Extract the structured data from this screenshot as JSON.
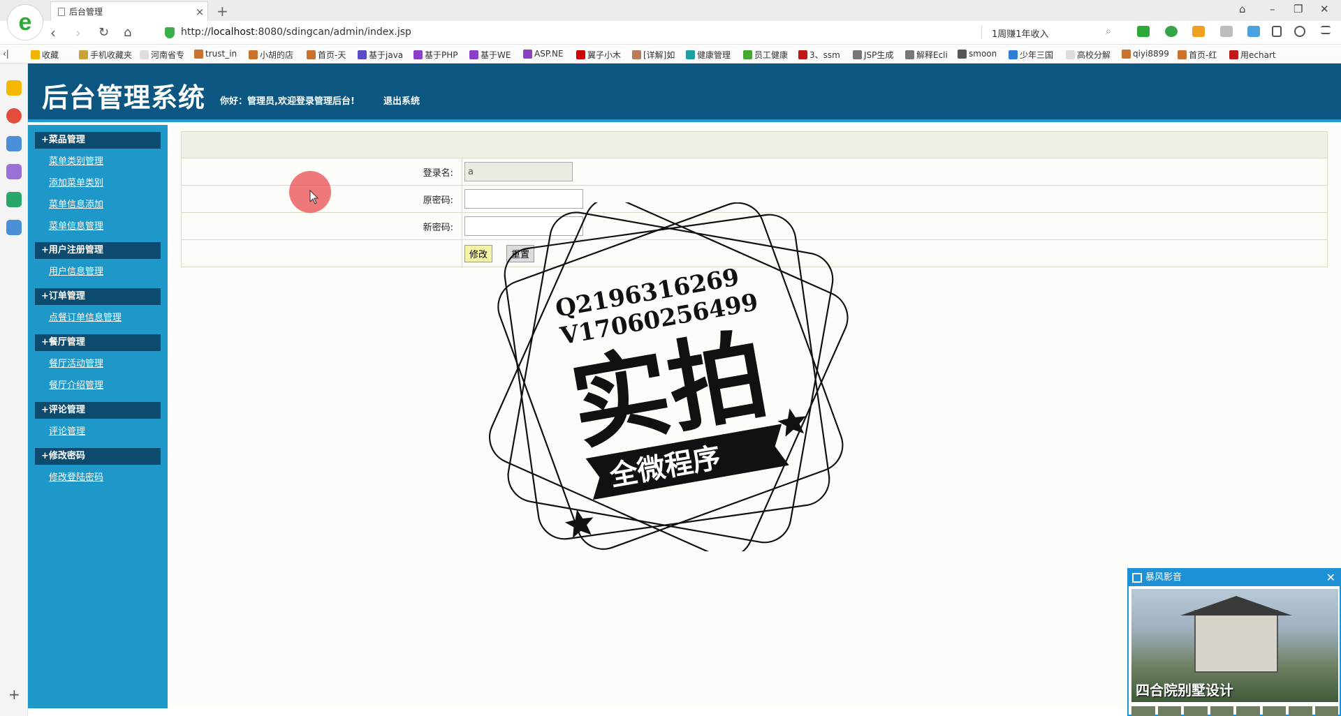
{
  "browser": {
    "tab_title": "后台管理",
    "url_prefix": "http://",
    "url_host": "localhost",
    "url_rest": ":8080/sdingcan/admin/index.jsp",
    "search_text": "1周赚1年收入",
    "bookmarks": [
      "收藏",
      "手机收藏夹",
      "河南省专",
      "trust_in",
      "小胡的店",
      "首页-天",
      "基于java",
      "基于PHP",
      "基于WE",
      "ASP.NE",
      "翼子小木",
      "[详解]如",
      "健康管理",
      "员工健康",
      "3、ssm",
      "JSP生成",
      "解释Ecli",
      "smoon",
      "少年三国",
      "高校分解",
      "qiyi8899",
      "首页-红",
      "用echart"
    ]
  },
  "header": {
    "title": "后台管理系统",
    "greeting": "你好：管理员,欢迎登录管理后台!",
    "logout": "退出系统"
  },
  "menu": [
    {
      "head": "+菜品管理",
      "links": [
        "菜单类别管理",
        "添加菜单类别",
        "菜单信息添加",
        "菜单信息管理"
      ]
    },
    {
      "head": "+用户注册管理",
      "links": [
        "用户信息管理"
      ]
    },
    {
      "head": "+订单管理",
      "links": [
        "点餐订单信息管理"
      ]
    },
    {
      "head": "+餐厅管理",
      "links": [
        "餐厅活动管理",
        "餐厅介绍管理"
      ]
    },
    {
      "head": "+评论管理",
      "links": [
        "评论管理"
      ]
    },
    {
      "head": "+修改密码",
      "links": [
        "修改登陆密码"
      ]
    }
  ],
  "form": {
    "login_label": "登录名:",
    "login_value": "a",
    "old_pw_label": "原密码:",
    "new_pw_label": "新密码:",
    "submit": "修改",
    "reset": "重置"
  },
  "watermark": {
    "line1": "Q2196316269",
    "line2": "V17060256499",
    "big": "实拍",
    "ribbon": "全微程序"
  },
  "ad": {
    "app": "暴风影音",
    "caption": "四合院别墅设计",
    "close": "✕"
  }
}
